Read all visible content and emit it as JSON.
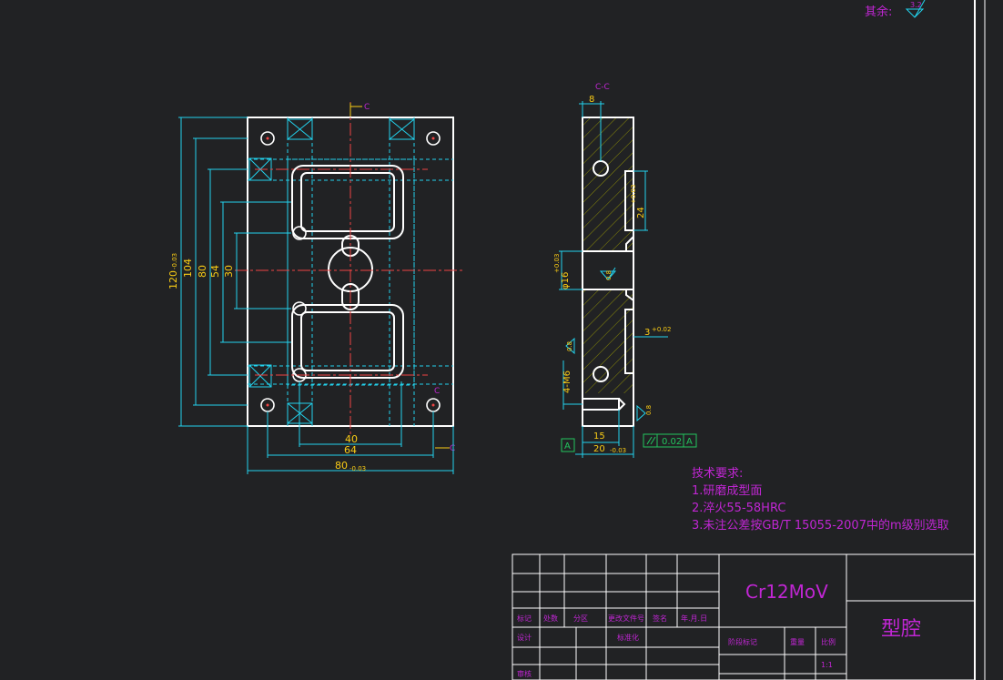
{
  "header": {
    "rest_label": "其余:",
    "rest_roughness": "3.2"
  },
  "front_view": {
    "section_marker": "C",
    "dims": {
      "height_total": "120",
      "height_total_tol": "-0.03",
      "h104": "104",
      "h80": "80",
      "h54": "54",
      "h30": "30",
      "w40": "40",
      "w64": "64",
      "width_total": "80",
      "width_total_tol": "-0.03"
    }
  },
  "section_view": {
    "title": "C-C",
    "dims": {
      "top_8": "8",
      "slot_24": "24",
      "slot_24_tol": "+0.03",
      "bore": "φ16",
      "bore_tol": "+0.03",
      "roughness_bore": "0.8",
      "roughness_left": "0.8",
      "roughness_right": "0.8",
      "groove_3": "3",
      "groove_3_tol": "+0.02",
      "thread": "4-M6",
      "w15": "15",
      "w20": "20",
      "w20_tol": "-0.03",
      "datum": "A",
      "parallel_tol": "0.02",
      "parallel_ref": "A"
    }
  },
  "requirements": {
    "title": "技术要求:",
    "items": [
      "1.研磨成型面",
      "2.淬火55-58HRC",
      "3.未注公差按GB/T 15055-2007中的m级别选取"
    ]
  },
  "title_block": {
    "material": "Cr12MoV",
    "part_name": "型腔",
    "row_labels": [
      "标记",
      "处数",
      "分区",
      "更改文件号",
      "签名",
      "年.月.日"
    ],
    "design": "设计",
    "standard": "标准化",
    "review": "审核",
    "stage": "阶段标记",
    "weight": "重量",
    "scale": "比例",
    "scale_value": "1:1"
  }
}
